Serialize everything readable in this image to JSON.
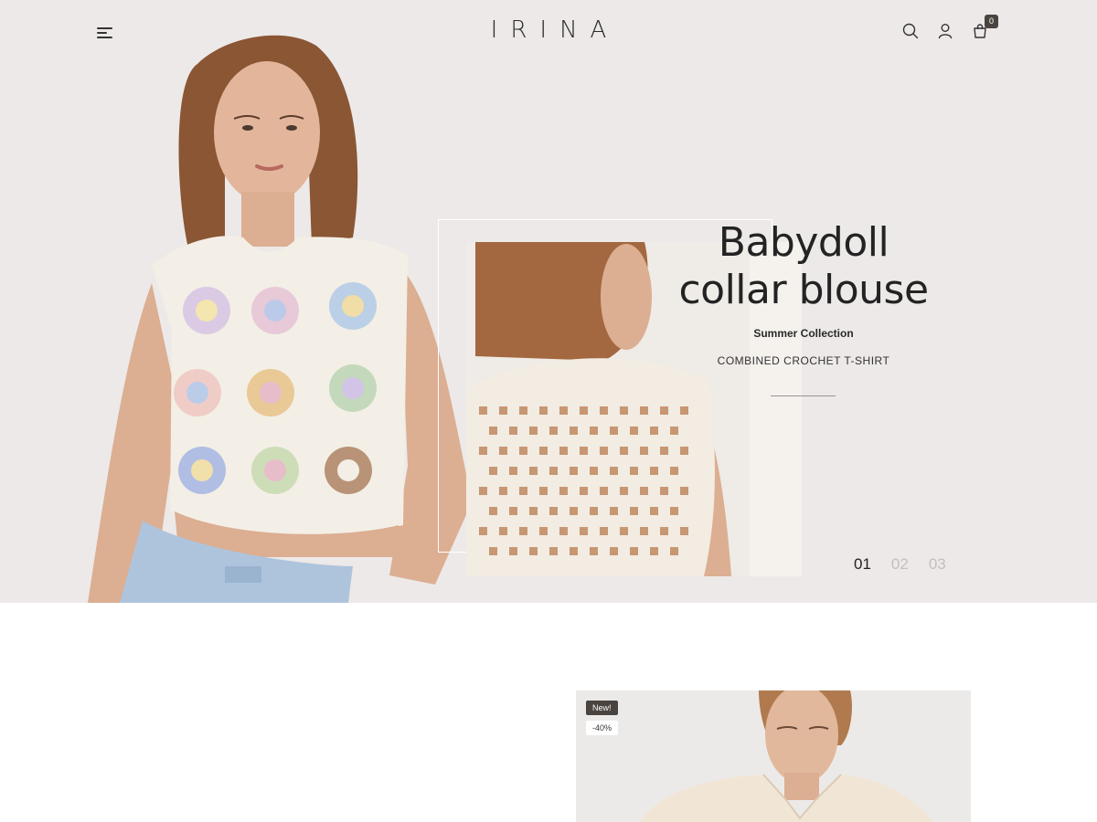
{
  "header": {
    "brand": "IRINA",
    "cart_count": "0"
  },
  "hero": {
    "title_line1": "Babydoll",
    "title_line2": "collar blouse",
    "subtitle": "Summer Collection",
    "caption": "COMBINED CROCHET T-SHIRT",
    "slides": [
      "01",
      "02",
      "03"
    ],
    "active_slide": "01"
  },
  "product": {
    "badge_new": "New!",
    "badge_discount": "-40%"
  },
  "colors": {
    "hero_bg": "#ede9e8",
    "text": "#232323",
    "badge_dark": "#4a4440"
  },
  "icons": [
    "menu-icon",
    "search-icon",
    "user-icon",
    "cart-icon"
  ]
}
